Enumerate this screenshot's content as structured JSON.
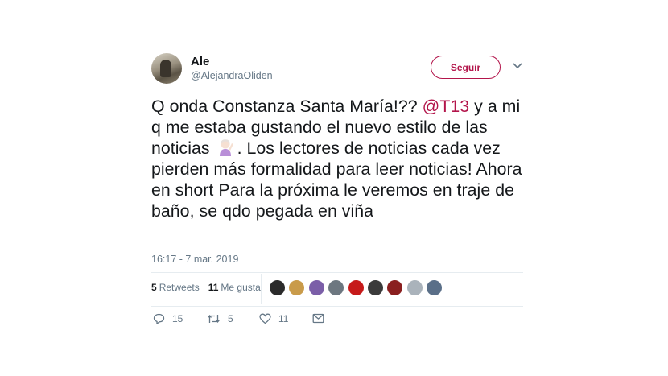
{
  "user": {
    "name": "Ale",
    "handle": "@AlejandraOliden"
  },
  "follow_button": "Seguir",
  "tweet": {
    "text_1": "Q onda Constanza Santa María!?? ",
    "mention": "@T13",
    "text_2": "  y a mi q me estaba gustando el nuevo estilo de las noticias ",
    "emoji": "woman-raising-hand-icon",
    "text_3": ". Los lectores de noticias cada vez pierden más formalidad para leer noticias! Ahora en short Para la próxima le veremos en traje de baño, se qdo pegada en viña",
    "timestamp": "16:17 - 7 mar. 2019"
  },
  "stats": {
    "retweets_count": "5",
    "retweets_label": "Retweets",
    "likes_count": "11",
    "likes_label": "Me gusta"
  },
  "likers": [
    {
      "name": "liker-avatar-1",
      "color": "#2b2b2b"
    },
    {
      "name": "liker-avatar-2",
      "color": "#c99b4a"
    },
    {
      "name": "liker-avatar-3",
      "color": "#7b5ea8"
    },
    {
      "name": "liker-avatar-4",
      "color": "#6d7780"
    },
    {
      "name": "liker-avatar-5",
      "color": "#c61a1a"
    },
    {
      "name": "liker-avatar-6",
      "color": "#3b3b3b"
    },
    {
      "name": "liker-avatar-7",
      "color": "#8a1f1f"
    },
    {
      "name": "liker-avatar-8",
      "color": "#aab3bb"
    },
    {
      "name": "liker-avatar-9",
      "color": "#5a6f88"
    }
  ],
  "actions": {
    "replies": "15",
    "retweets": "5",
    "likes": "11"
  },
  "colors": {
    "accent": "#b3154b",
    "secondary_text": "#657786",
    "divider": "#e6ecf0"
  }
}
